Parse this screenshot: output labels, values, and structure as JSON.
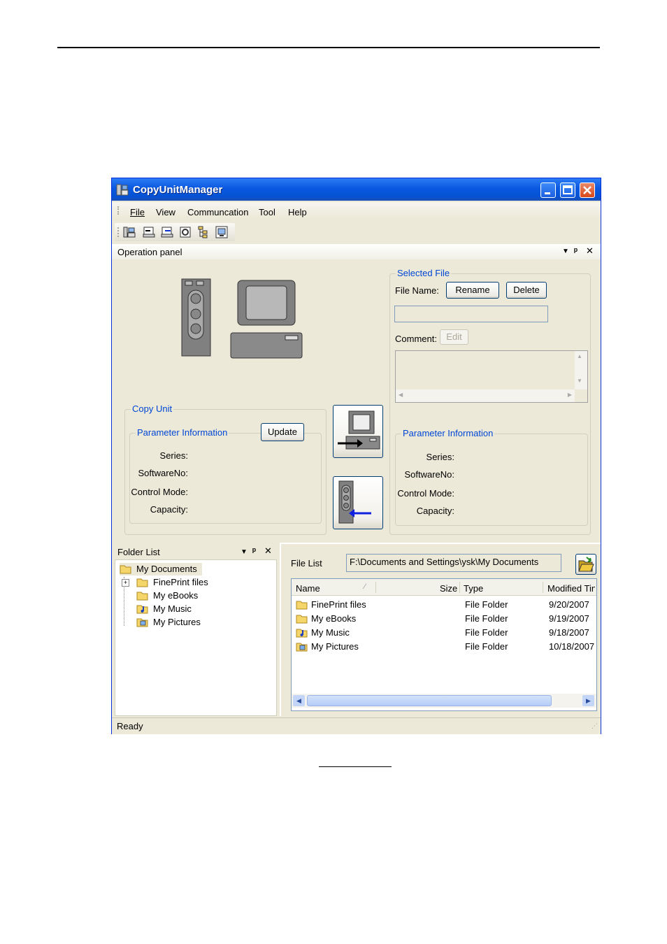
{
  "window": {
    "title": "CopyUnitManager",
    "controls": {
      "minimize": "minimize",
      "maximize": "maximize",
      "close": "close"
    }
  },
  "menu": [
    "File",
    "View",
    "Communcation",
    "Tool",
    "Help"
  ],
  "toolbar_icons": [
    "connect-icon",
    "send-file-icon",
    "receive-file-icon",
    "settings-icon",
    "tree-icon",
    "display-icon"
  ],
  "operation_panel": {
    "title": "Operation panel",
    "selected_file": {
      "group_title": "Selected File",
      "file_name_label": "File Name:",
      "rename_label": "Rename",
      "delete_label": "Delete",
      "file_name_value": "",
      "comment_label": "Comment:",
      "edit_label": "Edit",
      "comment_value": ""
    },
    "copy_unit": {
      "group_title": "Copy Unit",
      "param_title": "Parameter Information",
      "update_label": "Update",
      "series_label": "Series:",
      "software_label": "SoftwareNo:",
      "control_mode_label": "Control Mode:",
      "capacity_label": "Capacity:"
    },
    "pc_params": {
      "param_title": "Parameter Information",
      "series_label": "Series:",
      "software_label": "SoftwareNo:",
      "control_mode_label": "Control Mode:",
      "capacity_label": "Capacity:"
    }
  },
  "folder_list": {
    "title": "Folder List",
    "items": [
      "My Documents",
      "FinePrint files",
      "My eBooks",
      "My Music",
      "My Pictures"
    ]
  },
  "file_list": {
    "title": "File List",
    "path": "F:\\Documents and Settings\\ysk\\My Documents",
    "columns": {
      "name": "Name",
      "size": "Size",
      "type": "Type",
      "modified": "Modified Tin"
    },
    "rows": [
      {
        "name": "FinePrint files",
        "type": "File Folder",
        "modified": "9/20/2007"
      },
      {
        "name": "My eBooks",
        "type": "File Folder",
        "modified": "9/19/2007"
      },
      {
        "name": "My Music",
        "type": "File Folder",
        "modified": "9/18/2007"
      },
      {
        "name": "My Pictures",
        "type": "File Folder",
        "modified": "10/18/2007"
      }
    ]
  },
  "status": "Ready",
  "colors": {
    "title_blue": "#0a58e0",
    "group_label": "#0046d5",
    "panel_bg": "#ece9d8"
  }
}
